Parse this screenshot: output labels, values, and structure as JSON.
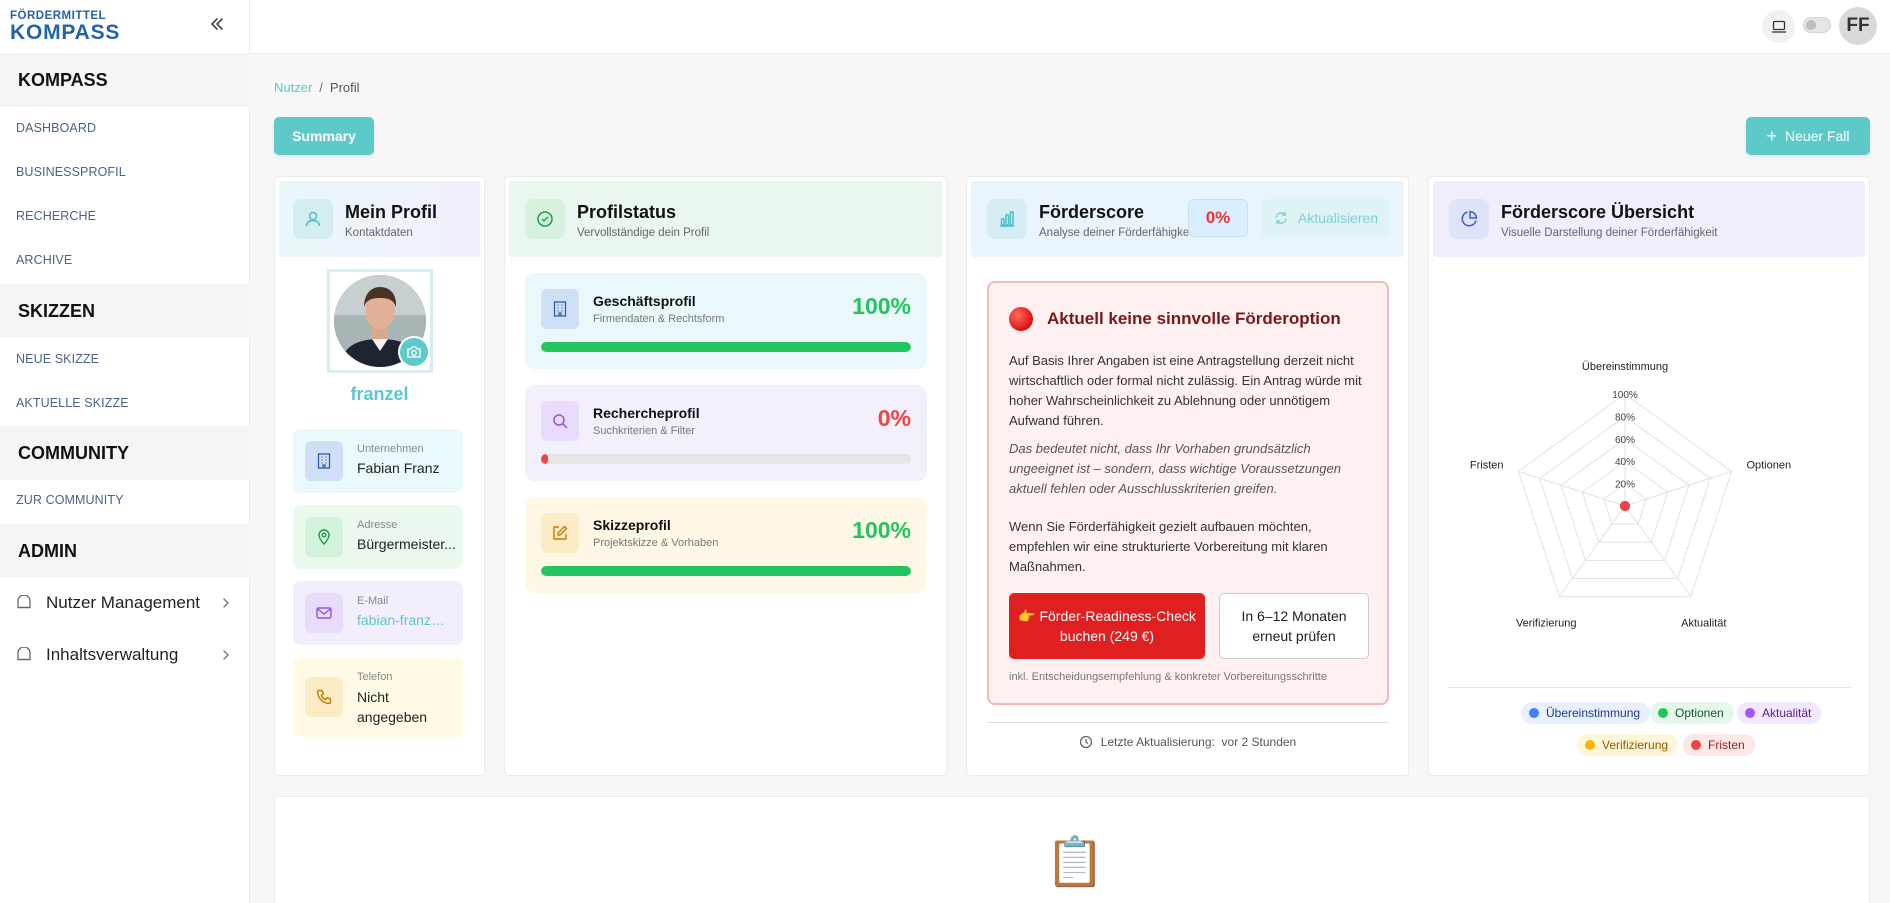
{
  "logo": {
    "line1": "FÖRDERMITTEL",
    "line2": "KOMPASS"
  },
  "sidebar": {
    "sections": [
      {
        "title": "KOMPASS",
        "items": [
          "DASHBOARD",
          "BUSINESSPROFIL",
          "RECHERCHE",
          "ARCHIVE"
        ]
      },
      {
        "title": "SKIZZEN",
        "items": [
          "NEUE SKIZZE",
          "AKTUELLE SKIZZE"
        ]
      },
      {
        "title": "COMMUNITY",
        "items": [
          "ZUR COMMUNITY"
        ]
      },
      {
        "title": "ADMIN",
        "items": []
      }
    ],
    "admin_items": [
      "Nutzer Management",
      "Inhaltsverwaltung"
    ]
  },
  "header": {
    "avatar_initials": "FF"
  },
  "breadcrumb": {
    "parent": "Nutzer",
    "separator": "/",
    "current": "Profil"
  },
  "actions": {
    "summary_label": "Summary",
    "new_case_label": "Neuer Fall"
  },
  "profile_card": {
    "title": "Mein Profil",
    "subtitle": "Kontaktdaten",
    "username": "franzel",
    "fields": [
      {
        "label": "Unternehmen",
        "value": "Fabian Franz"
      },
      {
        "label": "Adresse",
        "value": "Bürgermeister..."
      },
      {
        "label": "E-Mail",
        "value": "fabian-franz@f..."
      },
      {
        "label": "Telefon",
        "value": "Nicht angegeben"
      }
    ]
  },
  "status_card": {
    "title": "Profilstatus",
    "subtitle": "Vervollständige dein Profil",
    "items": [
      {
        "title": "Geschäftsprofil",
        "subtitle": "Firmendaten & Rechtsform",
        "percent_label": "100%",
        "progress": 100
      },
      {
        "title": "Rechercheprofil",
        "subtitle": "Suchkriterien & Filter",
        "percent_label": "0%",
        "progress": 0
      },
      {
        "title": "Skizzeprofil",
        "subtitle": "Projektskizze & Vorhaben",
        "percent_label": "100%",
        "progress": 100
      }
    ]
  },
  "score_card": {
    "title": "Förderscore",
    "subtitle": "Analyse deiner Förderfähigkeit",
    "score_label": "0%",
    "refresh_label": "Aktualisieren",
    "alert": {
      "title": "Aktuell keine sinnvolle Förderoption",
      "paragraph1": "Auf Basis Ihrer Angaben ist eine Antragstellung derzeit nicht wirtschaftlich oder formal nicht zulässig. Ein Antrag würde mit hoher Wahrscheinlichkeit zu Ablehnung oder unnötigem Aufwand führen.",
      "paragraph2": "Das bedeutet nicht, dass Ihr Vorhaben grundsätzlich ungeeignet ist – sondern, dass wichtige Voraussetzungen aktuell fehlen oder Ausschlusskriterien greifen.",
      "paragraph3": "Wenn Sie Förderfähigkeit gezielt aufbauen möchten, empfehlen wir eine strukturierte Vorbereitung mit klaren Maßnahmen.",
      "primary_button": "👉 Förder-Readiness-Check buchen (249 €)",
      "secondary_button": "In 6–12 Monaten erneut prüfen",
      "footnote": "inkl. Entscheidungsempfehlung & konkreter Vorbereitungsschritte"
    },
    "last_update_label": "Letzte Aktualisierung:",
    "last_update_value": "vor 2 Stunden"
  },
  "overview_card": {
    "title": "Förderscore Übersicht",
    "subtitle": "Visuelle Darstellung deiner Förderfähigkeit"
  },
  "chart_data": {
    "type": "radar",
    "axes": [
      "Übereinstimmung",
      "Optionen",
      "Aktualität",
      "Verifizierung",
      "Fristen"
    ],
    "ticks": [
      "20%",
      "40%",
      "60%",
      "80%",
      "100%"
    ],
    "range": [
      0,
      100
    ],
    "values": [
      0,
      0,
      0,
      0,
      0
    ],
    "legend": [
      {
        "name": "Übereinstimmung",
        "color": "#3b82f6",
        "bg": "#e8f0ff",
        "text": "#1e3a8a"
      },
      {
        "name": "Optionen",
        "color": "#22c55e",
        "bg": "#e6f8ec",
        "text": "#14532d"
      },
      {
        "name": "Aktualität",
        "color": "#a855f7",
        "bg": "#f3e8ff",
        "text": "#581c87"
      },
      {
        "name": "Verifizierung",
        "color": "#f5b800",
        "bg": "#fff6d9",
        "text": "#8a5a00"
      },
      {
        "name": "Fristen",
        "color": "#ef4444",
        "bg": "#fde8e8",
        "text": "#991b1b"
      }
    ],
    "legend_placement": "bottom",
    "point_color": "#ef4444"
  },
  "colors": {
    "accent": "#5ec9c9",
    "success": "#22c55e",
    "danger": "#e02020"
  },
  "bottom_card": {
    "icon": "📋"
  }
}
